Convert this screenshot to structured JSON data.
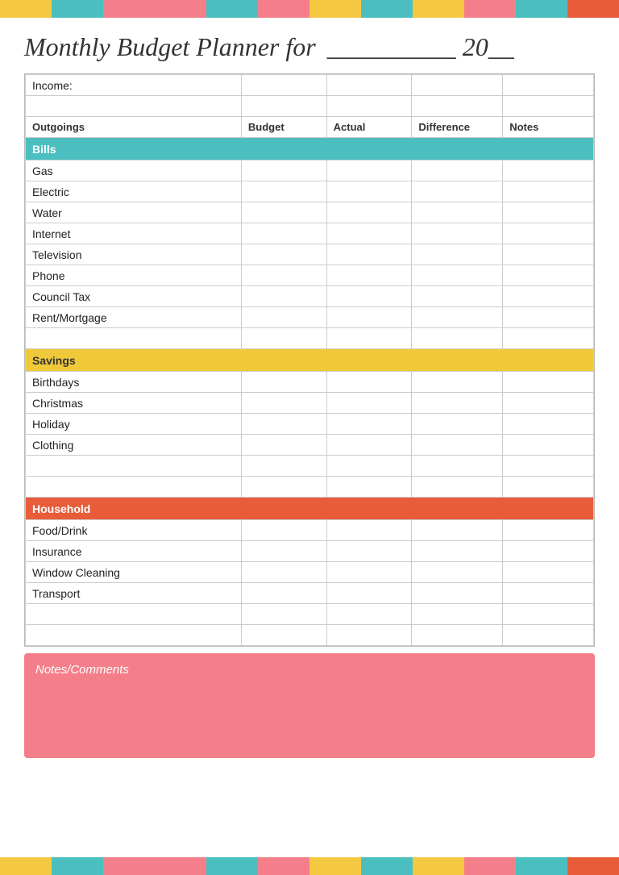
{
  "title": "Monthly Budget Planner for",
  "title_line": "__________ 20__",
  "top_strips": [
    {
      "color": "#f5c842"
    },
    {
      "color": "#4bbfbf"
    },
    {
      "color": "#f47f8a"
    },
    {
      "color": "#f47f8a"
    },
    {
      "color": "#4bbfbf"
    },
    {
      "color": "#f47f8a"
    },
    {
      "color": "#f5c842"
    },
    {
      "color": "#4bbfbf"
    },
    {
      "color": "#f5c842"
    },
    {
      "color": "#f47f8a"
    },
    {
      "color": "#4bbfbf"
    },
    {
      "color": "#e85c3a"
    }
  ],
  "bottom_strips": [
    {
      "color": "#f5c842"
    },
    {
      "color": "#4bbfbf"
    },
    {
      "color": "#f47f8a"
    },
    {
      "color": "#f47f8a"
    },
    {
      "color": "#4bbfbf"
    },
    {
      "color": "#f47f8a"
    },
    {
      "color": "#f5c842"
    },
    {
      "color": "#4bbfbf"
    },
    {
      "color": "#f5c842"
    },
    {
      "color": "#f47f8a"
    },
    {
      "color": "#4bbfbf"
    },
    {
      "color": "#e85c3a"
    }
  ],
  "income_label": "Income:",
  "columns": {
    "label": "Outgoings",
    "budget": "Budget",
    "actual": "Actual",
    "difference": "Difference",
    "notes": "Notes"
  },
  "sections": {
    "bills": {
      "header": "Bills",
      "items": [
        "Gas",
        "Electric",
        "Water",
        "Internet",
        "Television",
        "Phone",
        "Council Tax",
        "Rent/Mortgage"
      ]
    },
    "savings": {
      "header": "Savings",
      "items": [
        "Birthdays",
        "Christmas",
        "Holiday",
        "Clothing"
      ]
    },
    "household": {
      "header": "Household",
      "items": [
        "Food/Drink",
        "Insurance",
        "Window Cleaning",
        "Transport"
      ]
    }
  },
  "notes_label": "Notes/Comments"
}
